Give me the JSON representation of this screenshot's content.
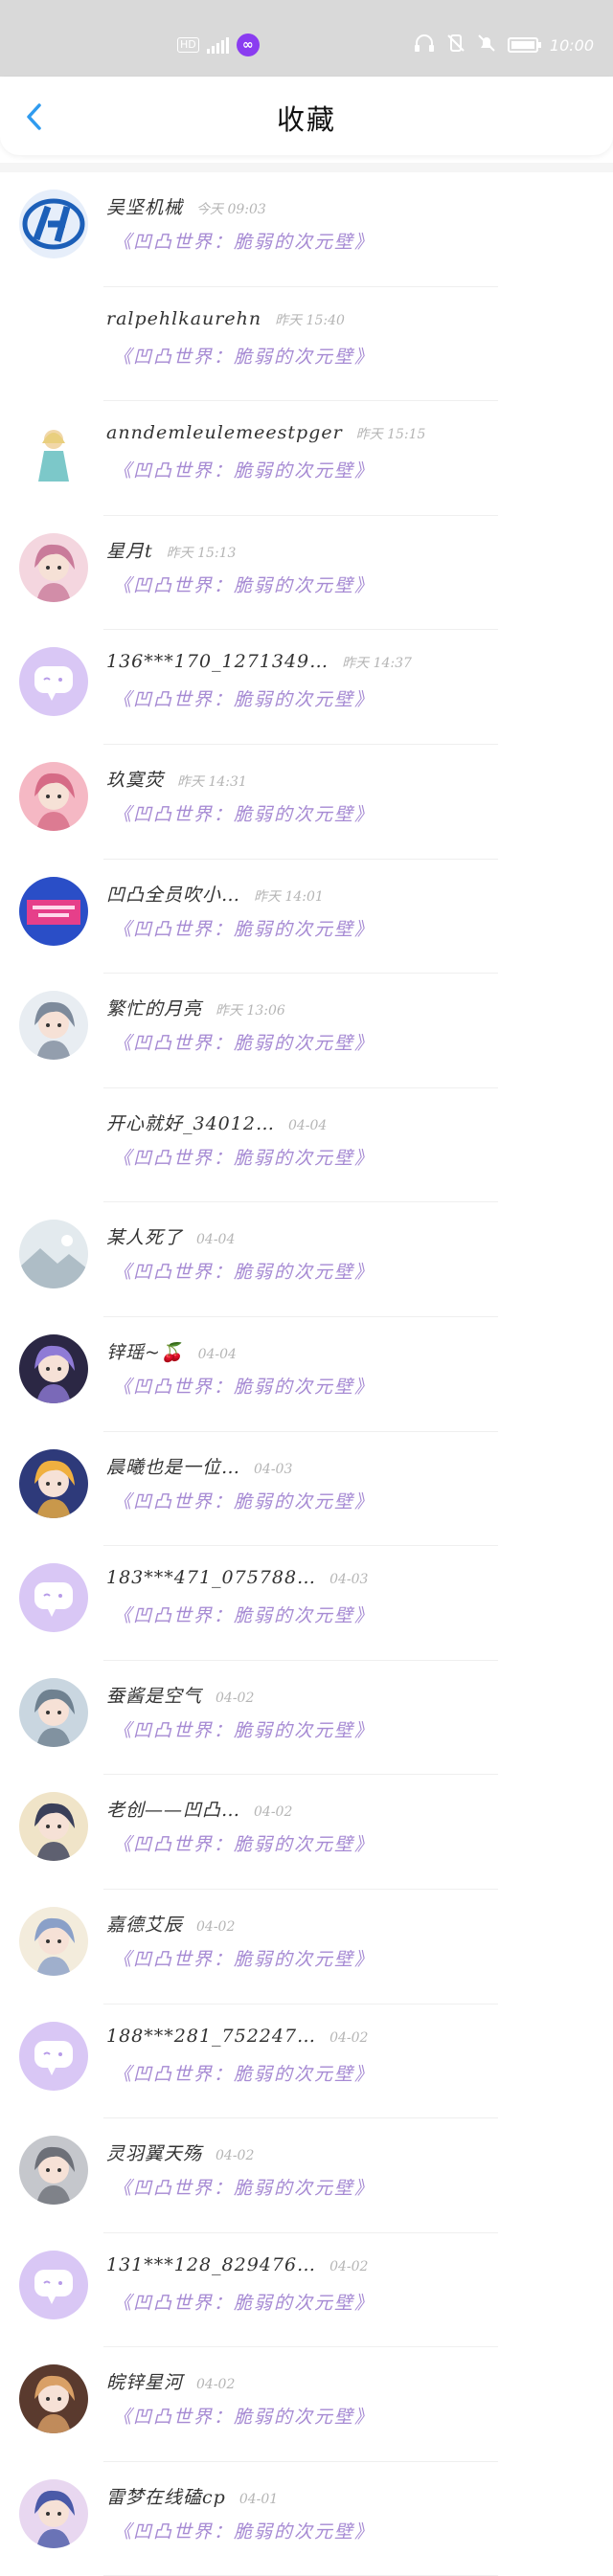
{
  "status_bar": {
    "hd_label": "HD",
    "time": "10:00",
    "app_icon": "purple-link-icon"
  },
  "nav": {
    "title": "收藏",
    "back_icon": "chevron-left-icon",
    "accent": "#2f9bef"
  },
  "items": [
    {
      "name": "吴坚机械",
      "time": "今天 09:03",
      "wall": "《凹凸世界：脆弱的次元壁》",
      "avatar": {
        "kind": "logo",
        "bg": "#e6eefa",
        "fg": "#1c5fb8"
      }
    },
    {
      "name": "ralpehlkaurehn",
      "time": "昨天 15:40",
      "wall": "《凹凸世界：脆弱的次元壁》",
      "avatar": {
        "kind": "none"
      }
    },
    {
      "name": "anndemleulemeestpger",
      "time": "昨天 15:15",
      "wall": "《凹凸世界：脆弱的次元壁》",
      "avatar": {
        "kind": "figure",
        "bg": "#ffffff",
        "fg": "#7cc8c9"
      }
    },
    {
      "name": "星月t",
      "time": "昨天 15:13",
      "wall": "《凹凸世界：脆弱的次元壁》",
      "avatar": {
        "kind": "anime",
        "bg": "#f4d6df",
        "fg": "#c97b9a"
      }
    },
    {
      "name": "136***170_1271349…",
      "time": "昨天 14:37",
      "wall": "《凹凸世界：脆弱的次元壁》",
      "avatar": {
        "kind": "default",
        "bg": "#d9c7f5",
        "fg": "#ffffff"
      }
    },
    {
      "name": "玖寞荧",
      "time": "昨天 14:31",
      "wall": "《凹凸世界：脆弱的次元壁》",
      "avatar": {
        "kind": "anime",
        "bg": "#f5b8c4",
        "fg": "#d66b86"
      }
    },
    {
      "name": "凹凸全员吹小…",
      "time": "昨天 14:01",
      "wall": "《凹凸世界：脆弱的次元壁》",
      "avatar": {
        "kind": "banner",
        "bg": "#2a4ec7",
        "fg": "#e63f8a"
      }
    },
    {
      "name": "繁忙的月亮",
      "time": "昨天 13:06",
      "wall": "《凹凸世界：脆弱的次元壁》",
      "avatar": {
        "kind": "anime",
        "bg": "#e8edf2",
        "fg": "#7d8a9b"
      }
    },
    {
      "name": "开心就好_34012…",
      "time": "04-04",
      "wall": "《凹凸世界：脆弱的次元壁》",
      "avatar": {
        "kind": "none"
      }
    },
    {
      "name": "某人死了",
      "time": "04-04",
      "wall": "《凹凸世界：脆弱的次元壁》",
      "avatar": {
        "kind": "landscape",
        "bg": "#e3eaee",
        "fg": "#aebdc6"
      }
    },
    {
      "name": "锌瑶~🍒",
      "time": "04-04",
      "wall": "《凹凸世界：脆弱的次元壁》",
      "avatar": {
        "kind": "anime",
        "bg": "#2b2744",
        "fg": "#8f7bd6"
      }
    },
    {
      "name": "晨曦也是一位…",
      "time": "04-03",
      "wall": "《凹凸世界：脆弱的次元壁》",
      "avatar": {
        "kind": "anime",
        "bg": "#2e3a7a",
        "fg": "#f0b040"
      }
    },
    {
      "name": "183***471_075788…",
      "time": "04-03",
      "wall": "《凹凸世界：脆弱的次元壁》",
      "avatar": {
        "kind": "default",
        "bg": "#d9c7f5",
        "fg": "#ffffff"
      }
    },
    {
      "name": "蚕酱是空气",
      "time": "04-02",
      "wall": "《凹凸世界：脆弱的次元壁》",
      "avatar": {
        "kind": "anime",
        "bg": "#c9d6e0",
        "fg": "#6f8190"
      }
    },
    {
      "name": "老创——凹凸…",
      "time": "04-02",
      "wall": "《凹凸世界：脆弱的次元壁》",
      "avatar": {
        "kind": "anime",
        "bg": "#f0e4c8",
        "fg": "#3a3f5a"
      }
    },
    {
      "name": "嘉德艾辰",
      "time": "04-02",
      "wall": "《凹凸世界：脆弱的次元壁》",
      "avatar": {
        "kind": "anime",
        "bg": "#f3ecdc",
        "fg": "#8aa0c8"
      }
    },
    {
      "name": "188***281_752247…",
      "time": "04-02",
      "wall": "《凹凸世界：脆弱的次元壁》",
      "avatar": {
        "kind": "default",
        "bg": "#d9c7f5",
        "fg": "#ffffff"
      }
    },
    {
      "name": "灵羽翼天殇",
      "time": "04-02",
      "wall": "《凹凸世界：脆弱的次元壁》",
      "avatar": {
        "kind": "anime",
        "bg": "#c5c7cc",
        "fg": "#6d7078"
      }
    },
    {
      "name": "131***128_829476…",
      "time": "04-02",
      "wall": "《凹凸世界：脆弱的次元壁》",
      "avatar": {
        "kind": "default",
        "bg": "#d9c7f5",
        "fg": "#ffffff"
      }
    },
    {
      "name": "皖锌星河",
      "time": "04-02",
      "wall": "《凹凸世界：脆弱的次元壁》",
      "avatar": {
        "kind": "anime",
        "bg": "#5a3a2e",
        "fg": "#d9a066"
      }
    },
    {
      "name": "雷梦在线磕cp",
      "time": "04-01",
      "wall": "《凹凸世界：脆弱的次元壁》",
      "avatar": {
        "kind": "anime",
        "bg": "#e8d7f0",
        "fg": "#4a5aa8"
      }
    }
  ]
}
